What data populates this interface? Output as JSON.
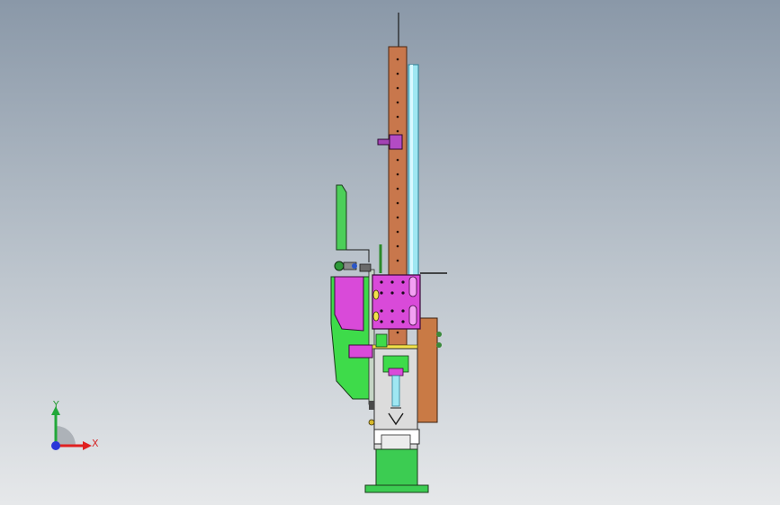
{
  "triad": {
    "x_label": "X",
    "y_label": "Y",
    "colors": {
      "x": "#e02020",
      "y": "#22a83a",
      "z": "#2a36d8"
    }
  },
  "viewport": {
    "background_top": "#8a98a8",
    "background_bottom": "#e6e8ea"
  },
  "model": {
    "colors": {
      "rail": "#c8774c",
      "rod": "#9fe7f2",
      "bracket": "#d94ad9",
      "body": "#3edb4a",
      "plate": "#d9874f",
      "base": "#3ccc52"
    }
  }
}
